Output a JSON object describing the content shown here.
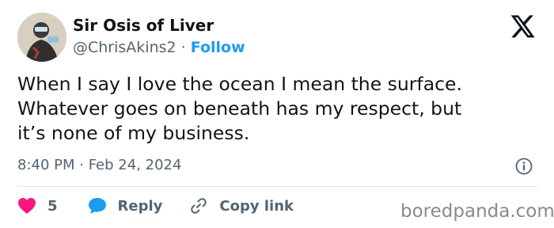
{
  "author": {
    "display_name": "Sir Osis of Liver",
    "handle": "@ChrisAkins2",
    "separator": "·",
    "follow_label": "Follow"
  },
  "tweet": {
    "lines": [
      "When I say I love the ocean I mean the surface.",
      "Whatever goes on beneath has my respect, but",
      "it’s none of my business."
    ],
    "timestamp": "8:40 PM · Feb 24, 2024"
  },
  "actions": {
    "likes_count": "5",
    "reply_label": "Reply",
    "copy_link_label": "Copy link"
  },
  "watermark": "boredpanda.com",
  "icons": {
    "logo": "x-logo-icon",
    "info": "info-icon",
    "like": "heart-icon",
    "reply": "speech-bubble-icon",
    "copy": "link-icon"
  },
  "colors": {
    "accent": "#1d9bf0",
    "like": "#f91880",
    "text": "#0f1419",
    "secondary": "#536471"
  }
}
